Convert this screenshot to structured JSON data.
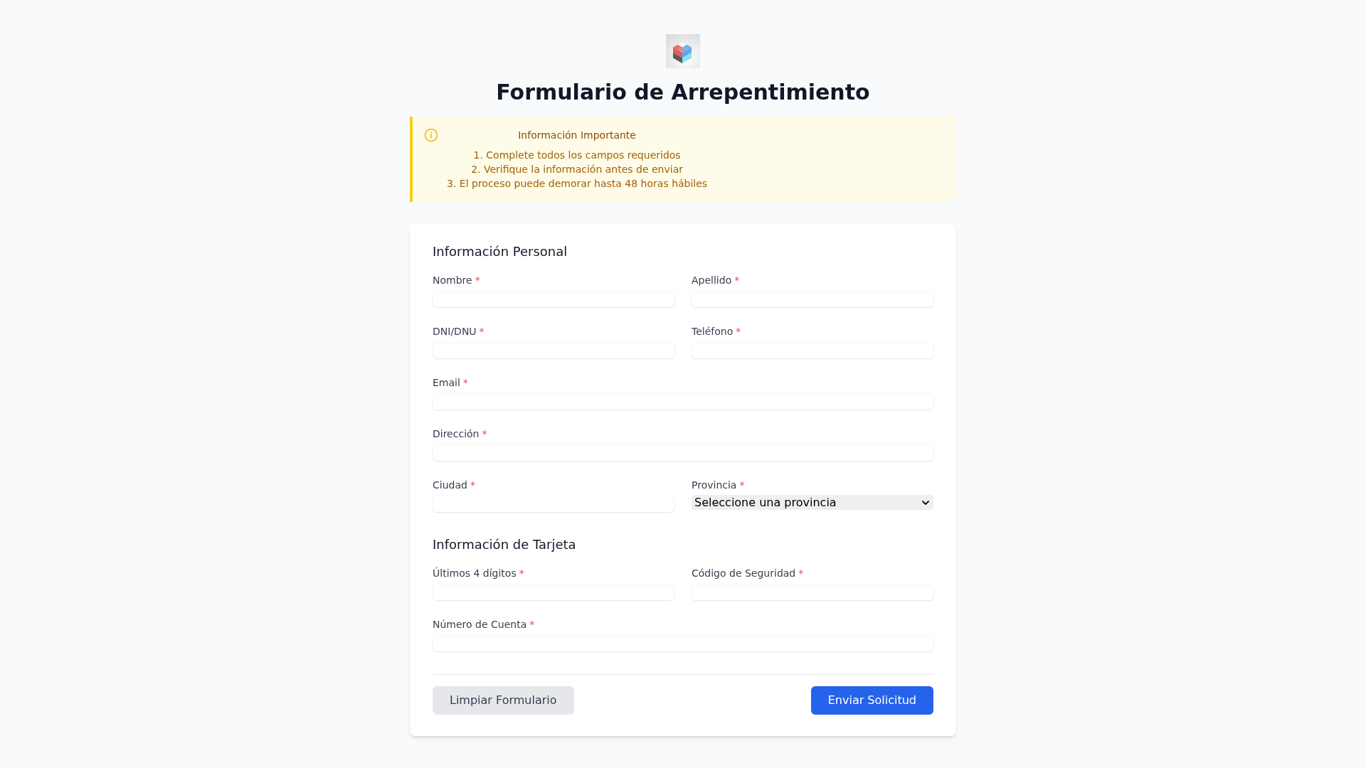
{
  "header": {
    "title": "Formulario de Arrepentimiento"
  },
  "notice": {
    "title": "Información Importante",
    "items": [
      "1. Complete todos los campos requeridos",
      "2. Verifique la información antes de enviar",
      "3. El proceso puede demorar hasta 48 horas hábiles"
    ]
  },
  "form": {
    "sections": [
      {
        "title": "Información Personal",
        "rows": [
          {
            "fields": [
              {
                "label": "Nombre",
                "mark": "*",
                "kind": "text"
              },
              {
                "label": "Apellido",
                "mark": "*",
                "kind": "text"
              }
            ]
          },
          {
            "fields": [
              {
                "label": "DNI/DNU",
                "mark": "*",
                "kind": "text"
              },
              {
                "label": "Teléfono",
                "mark": "*",
                "kind": "text"
              }
            ]
          },
          {
            "fields": [
              {
                "label": "Email",
                "mark": "*",
                "kind": "text"
              }
            ]
          },
          {
            "fields": [
              {
                "label": "Dirección",
                "mark": "*",
                "kind": "text"
              }
            ]
          },
          {
            "fields": [
              {
                "label": "Ciudad",
                "mark": "*",
                "kind": "text"
              },
              {
                "label": "Provincia",
                "mark": "*",
                "kind": "select",
                "value": "Seleccione una provincia"
              }
            ]
          }
        ]
      },
      {
        "title": "Información de Tarjeta",
        "rows": [
          {
            "fields": [
              {
                "label": "Últimos 4 dígitos",
                "mark": "*",
                "kind": "text"
              },
              {
                "label": "Código de Seguridad",
                "mark": "*",
                "kind": "text"
              }
            ]
          },
          {
            "fields": [
              {
                "label": "Número de Cuenta",
                "mark": "*",
                "kind": "text"
              }
            ]
          }
        ]
      }
    ],
    "buttons": [
      {
        "label": "Limpiar Formulario",
        "kind": "reset"
      },
      {
        "label": "Enviar Solicitud",
        "kind": "submit"
      }
    ]
  }
}
